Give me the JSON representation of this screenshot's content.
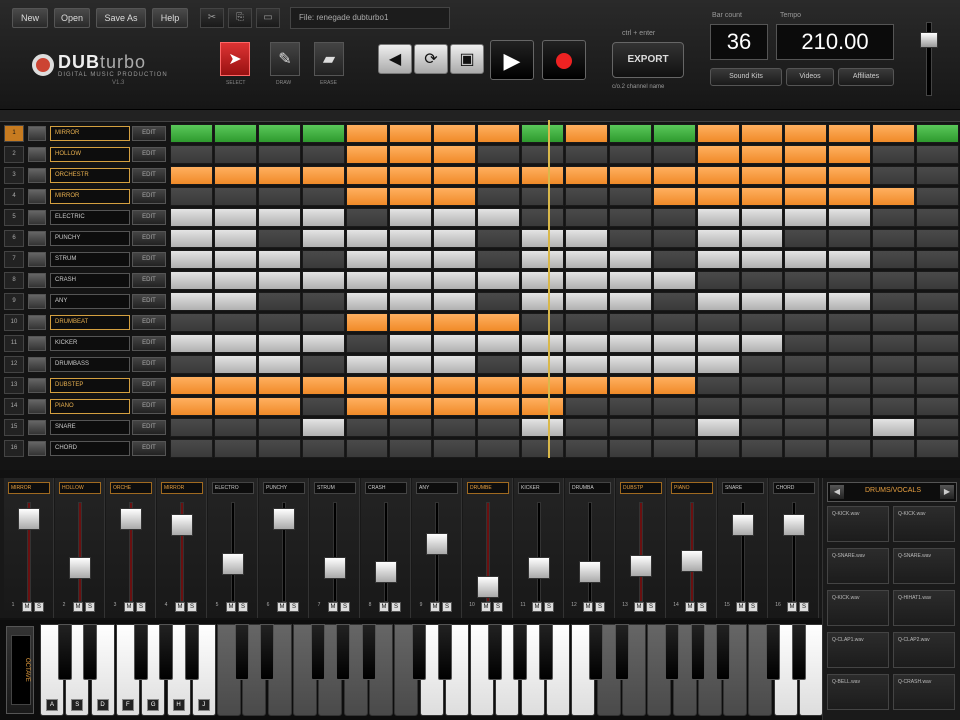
{
  "menu": {
    "new": "New",
    "open": "Open",
    "save_as": "Save As",
    "help": "Help"
  },
  "file": {
    "label": "File: renegade dubturbo1"
  },
  "logo": {
    "brand_a": "DUB",
    "brand_b": "turbo",
    "subtitle": "DIGITAL MUSIC PRODUCTION",
    "version": "V1.3"
  },
  "tools": {
    "select_lbl": "SELECT",
    "draw_lbl": "DRAW",
    "erase_lbl": "ERASE"
  },
  "transport": {
    "ctrl_enter": "ctrl + enter",
    "ctrl_name": "c/o.2 channel name"
  },
  "export": {
    "label": "EXPORT"
  },
  "bars": {
    "label": "Bar count",
    "value": "36"
  },
  "tempo": {
    "label": "Tempo",
    "value": "210.00"
  },
  "buttons": {
    "sound_kits": "Sound Kits",
    "videos": "Videos",
    "affiliates": "Affiliates"
  },
  "tracks": [
    {
      "num": "1",
      "name": "MIRROR",
      "on": true,
      "edit": "EDIT"
    },
    {
      "num": "2",
      "name": "HOLLOW",
      "on": true,
      "edit": "EDIT"
    },
    {
      "num": "3",
      "name": "ORCHESTR",
      "on": true,
      "edit": "EDIT"
    },
    {
      "num": "4",
      "name": "MIRROR",
      "on": true,
      "edit": "EDIT"
    },
    {
      "num": "5",
      "name": "ELECTRIC",
      "on": false,
      "edit": "EDIT"
    },
    {
      "num": "6",
      "name": "PUNCHY",
      "on": false,
      "edit": "EDIT"
    },
    {
      "num": "7",
      "name": "STRUM",
      "on": false,
      "edit": "EDIT"
    },
    {
      "num": "8",
      "name": "CRASH",
      "on": false,
      "edit": "EDIT"
    },
    {
      "num": "9",
      "name": "ANY",
      "on": false,
      "edit": "EDIT"
    },
    {
      "num": "10",
      "name": "DRUMBEAT",
      "on": true,
      "edit": "EDIT"
    },
    {
      "num": "11",
      "name": "KICKER",
      "on": false,
      "edit": "EDIT"
    },
    {
      "num": "12",
      "name": "DRUMBASS",
      "on": false,
      "edit": "EDIT"
    },
    {
      "num": "13",
      "name": "DUBSTEP",
      "on": true,
      "edit": "EDIT"
    },
    {
      "num": "14",
      "name": "PIANO",
      "on": true,
      "edit": "EDIT"
    },
    {
      "num": "15",
      "name": "SNARE",
      "on": false,
      "edit": "EDIT"
    },
    {
      "num": "16",
      "name": "CHORD",
      "on": false,
      "edit": "EDIT"
    }
  ],
  "grid": {
    "cols": 18,
    "rows": [
      "ggggoooogoggooooog",
      "....ooo.....oooo..",
      "oooooooooooooooo..",
      "....ooo....oooooo.",
      "wwww.www....wwww..",
      "ww.wwww.ww..ww....",
      "www.www.www.wwww..",
      "wwwwwwwwwwww......",
      "ww..www.www.wwww..",
      "....oooo..........",
      "wwww.wwwwwwwww....",
      ".ww.www.wwwww.....",
      "oooooooooooo......",
      "ooo.ooooo.........",
      "...w....w...w...w.",
      "..................."
    ]
  },
  "mixer": [
    {
      "name": "MIRROR",
      "on": true,
      "level": 0.92
    },
    {
      "name": "HOLLOW",
      "on": true,
      "level": 0.3
    },
    {
      "name": "ORCHE",
      "on": true,
      "level": 0.92
    },
    {
      "name": "MIRROR",
      "on": true,
      "level": 0.85
    },
    {
      "name": "ELECTRO",
      "on": false,
      "level": 0.35
    },
    {
      "name": "PUNCHY",
      "on": false,
      "level": 0.92
    },
    {
      "name": "STRUM",
      "on": false,
      "level": 0.3
    },
    {
      "name": "CRASH",
      "on": false,
      "level": 0.25
    },
    {
      "name": "ANY",
      "on": false,
      "level": 0.6
    },
    {
      "name": "DRUMBE",
      "on": true,
      "level": 0.05
    },
    {
      "name": "KICKER",
      "on": false,
      "level": 0.3
    },
    {
      "name": "DRUMBA",
      "on": false,
      "level": 0.25
    },
    {
      "name": "DUBSTP",
      "on": true,
      "level": 0.32
    },
    {
      "name": "PIANO",
      "on": true,
      "level": 0.38
    },
    {
      "name": "SNARE",
      "on": false,
      "level": 0.85
    },
    {
      "name": "CHORD",
      "on": false,
      "level": 0.85
    }
  ],
  "browser": {
    "title": "DRUMS/VOCALS",
    "samples": [
      "Q-KICK.wav",
      "Q-KICK.wav",
      "Q-SNARE.wav",
      "Q-SNARE.wav",
      "Q-KICK.wav",
      "Q-HIHAT1.wav",
      "Q-CLAP1.wav",
      "Q-CLAP2.wav",
      "Q-BELL.wav",
      "Q-CRASH.wav"
    ]
  },
  "keyboard": {
    "octave_label": "OCTAVE",
    "key_labels": [
      "A",
      "S",
      "D",
      "F",
      "G",
      "H",
      "J"
    ]
  },
  "colors": {
    "orange": "#f08a28",
    "green": "#2e9a2e",
    "gold": "#d9b84a"
  }
}
